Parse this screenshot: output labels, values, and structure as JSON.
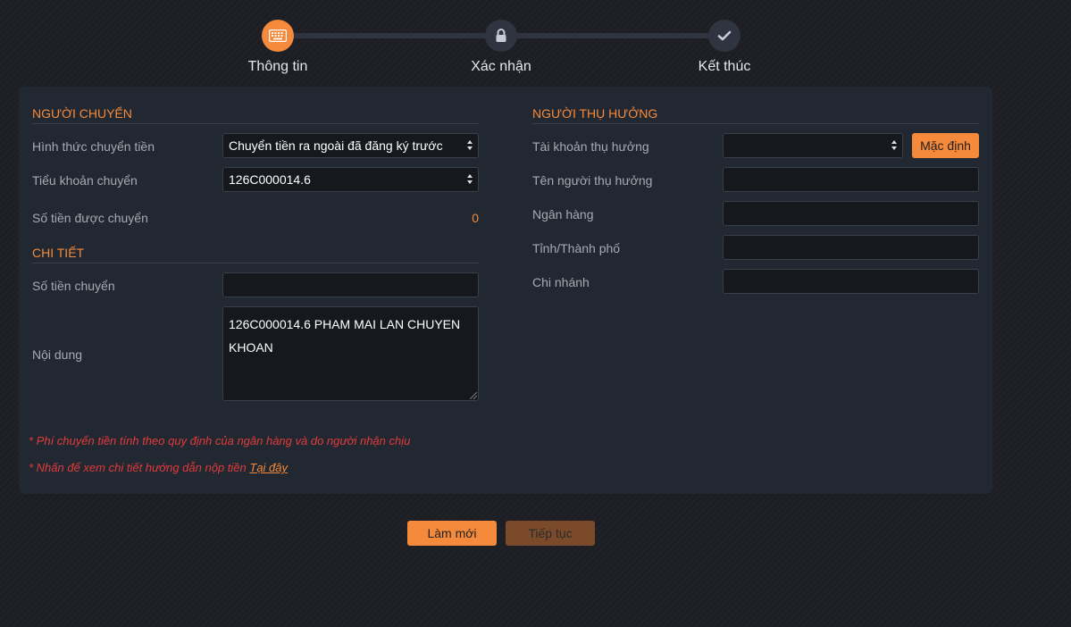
{
  "stepper": {
    "steps": [
      {
        "label": "Thông tin",
        "icon": "keyboard-icon",
        "active": true
      },
      {
        "label": "Xác nhận",
        "icon": "lock-icon",
        "active": false
      },
      {
        "label": "Kết thúc",
        "icon": "check-icon",
        "active": false
      }
    ]
  },
  "sender": {
    "title": "NGƯỜI CHUYỂN",
    "transfer_type_label": "Hình thức chuyển tiền",
    "transfer_type_value": "Chuyển tiền ra ngoài đã đăng ký trước",
    "sub_account_label": "Tiểu khoản chuyển",
    "sub_account_value": "126C000014.6",
    "transferable_label": "Số tiền được chuyển",
    "transferable_value": "0"
  },
  "detail": {
    "title": "CHI TIẾT",
    "amount_label": "Số tiền chuyển",
    "amount_value": "",
    "content_label": "Nội dung",
    "content_value": "126C000014.6 PHAM MAI LAN CHUYEN KHOAN"
  },
  "beneficiary": {
    "title": "NGƯỜI THỤ HƯỞNG",
    "account_label": "Tài khoản thụ hưởng",
    "account_value": "",
    "default_button": "Mặc định",
    "name_label": "Tên người thụ hưởng",
    "name_value": "",
    "bank_label": "Ngân hàng",
    "bank_value": "",
    "city_label": "Tỉnh/Thành phố",
    "city_value": "",
    "branch_label": "Chi nhánh",
    "branch_value": ""
  },
  "notes": {
    "fee_note": "* Phí chuyển tiền tính theo quy định của ngân hàng và do người nhận chịu",
    "guide_note": "* Nhấn để xem chi tiết hướng dẫn nộp tiền ",
    "guide_link": "Tại đây"
  },
  "actions": {
    "reset_label": "Làm mới",
    "continue_label": "Tiếp tục"
  },
  "colors": {
    "accent": "#f58a3c",
    "background": "#1c1e23",
    "card": "#222831",
    "error": "#e23b3b"
  }
}
